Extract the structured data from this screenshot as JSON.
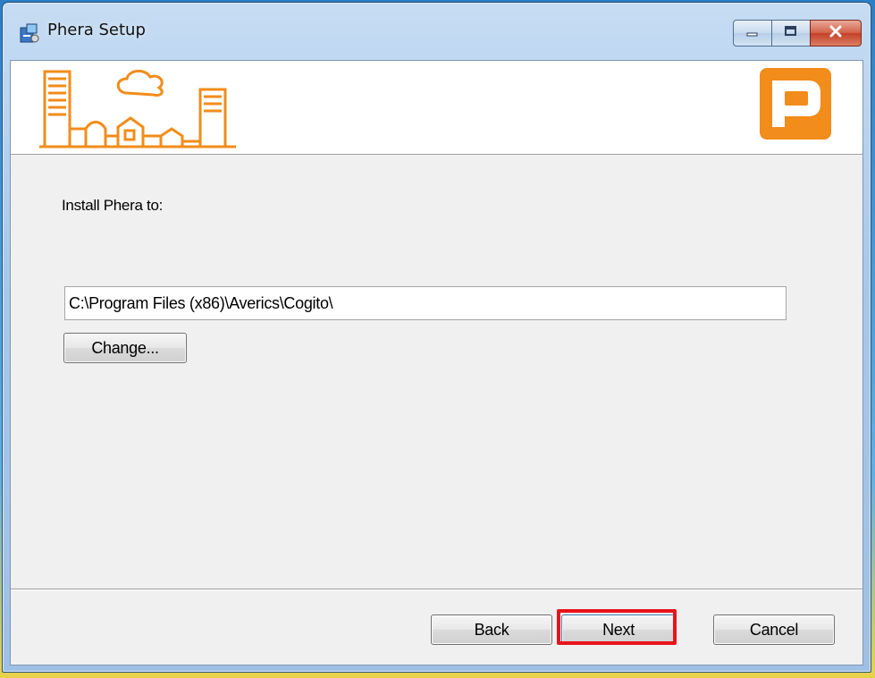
{
  "window": {
    "title": "Phera Setup",
    "icons": {
      "app": "installer-icon",
      "minimize": "minimize-icon",
      "maximize": "maximize-icon",
      "close": "close-icon"
    }
  },
  "banner": {
    "art": "city-skyline-illustration",
    "logo": "phera-logo",
    "brand_color": "#f28c1a"
  },
  "main": {
    "install_label": "Install Phera to:",
    "install_path": "C:\\Program Files (x86)\\Averics\\Cogito\\",
    "change_label": "Change..."
  },
  "footer": {
    "back_label": "Back",
    "next_label": "Next",
    "cancel_label": "Cancel",
    "highlight_color": "#e8141c"
  }
}
